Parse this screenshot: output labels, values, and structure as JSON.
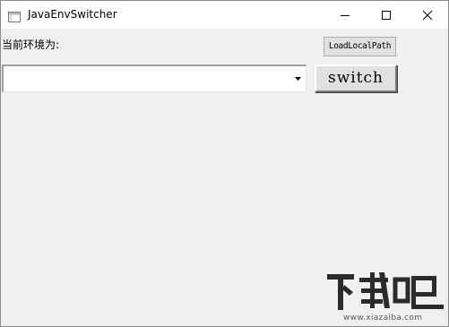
{
  "window": {
    "title": "JavaEnvSwitcher",
    "icon": "app-window-icon",
    "controls": [
      "minimize-icon",
      "maximize-icon",
      "close-icon"
    ]
  },
  "main": {
    "current_env_label": "当前环境为:",
    "load_button_label": "LoadLocalPath",
    "env_select": {
      "selected_value": ""
    },
    "switch_button_label": "switch"
  },
  "watermark": {
    "logo_text": "下载吧",
    "url": "www.xiazaiba.com"
  },
  "colors": {
    "window_bg": "#f0f0f0",
    "titlebar_bg": "#ffffff",
    "button_bg": "#e1e1e1",
    "button_border": "#adadad"
  }
}
